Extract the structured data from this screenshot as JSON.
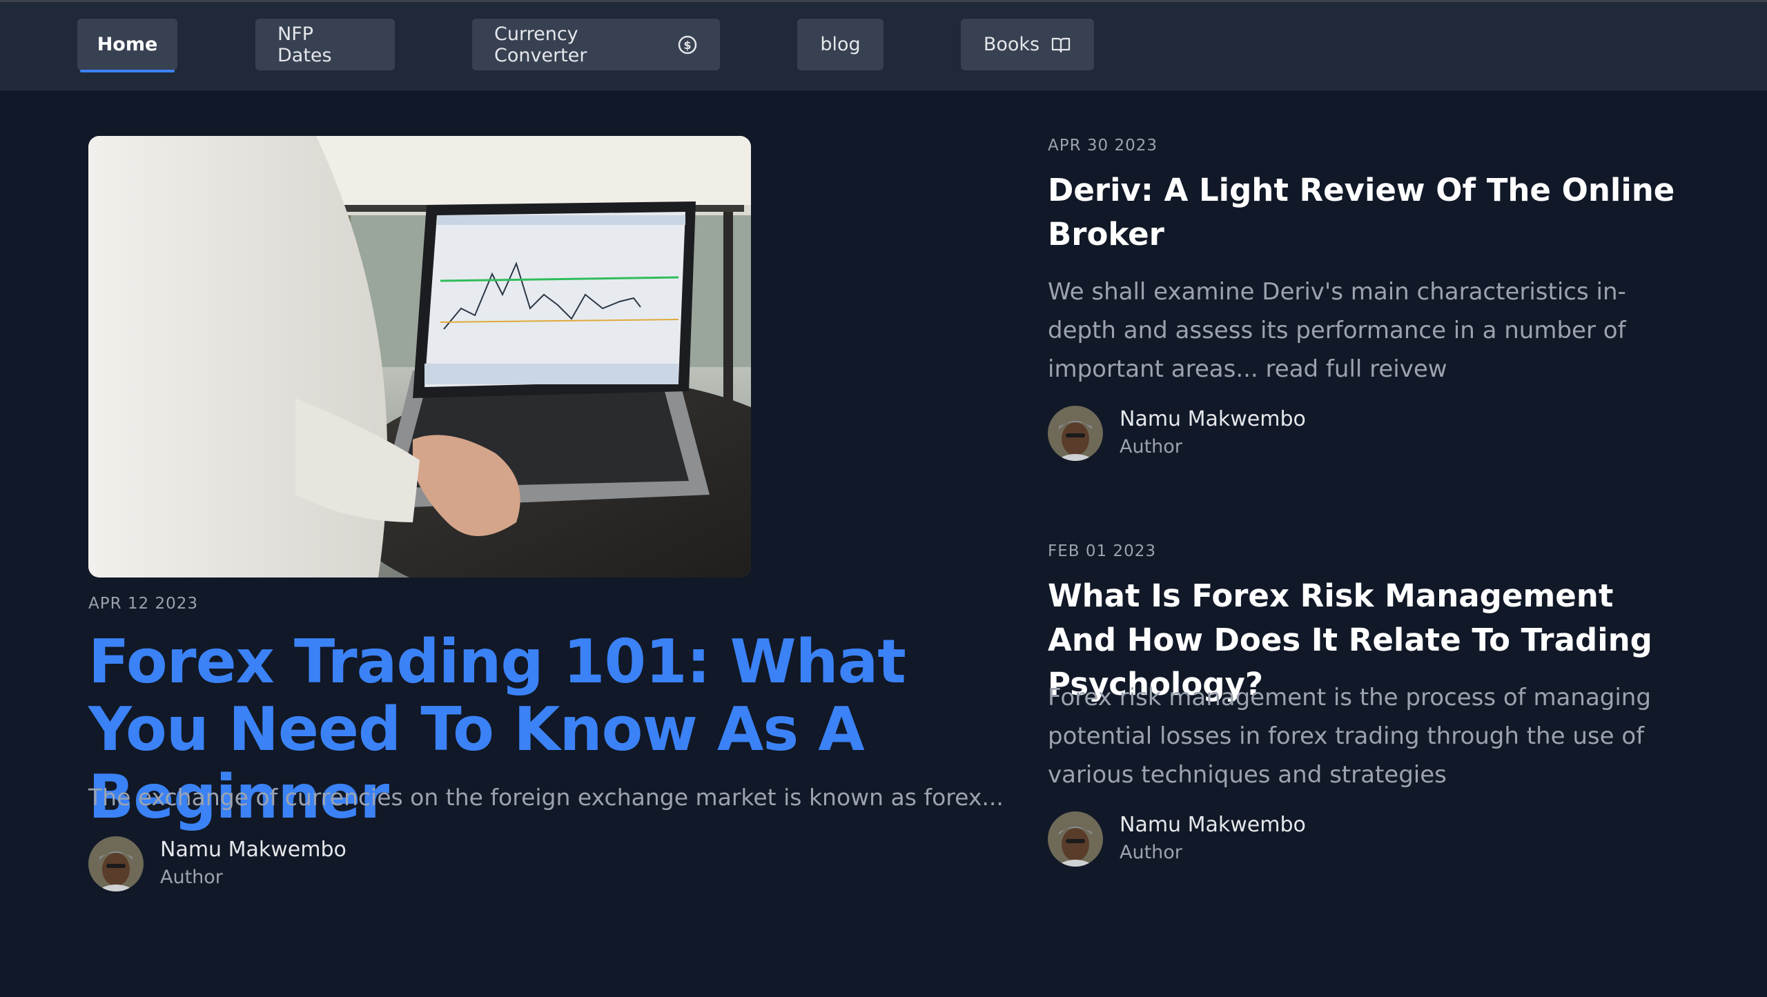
{
  "nav": {
    "home": "Home",
    "nfp": "NFP Dates",
    "converter": "Currency Converter",
    "blog": "blog",
    "books": "Books"
  },
  "featured": {
    "date": "APR 12 2023",
    "title": "Forex Trading 101: What You Need To Know As A Beginner",
    "excerpt": "The exchange of currencies on the foreign exchange market is known as forex...",
    "image_icon": "laptop-trading-chart-photo",
    "author_name": "Namu Makwembo",
    "author_role": "Author"
  },
  "posts": [
    {
      "date": "APR 30 2023",
      "title": "Deriv: A Light Review Of The Online Broker",
      "excerpt": "We shall examine Deriv's main characteristics in-depth and assess its performance in a number of important areas... read full reivew",
      "author_name": "Namu Makwembo",
      "author_role": "Author"
    },
    {
      "date": "FEB 01 2023",
      "title": "What Is Forex Risk Management And How Does It Relate To Trading Psychology?",
      "excerpt": "Forex risk management is the process of managing potential losses in forex trading through the use of various techniques and strategies",
      "author_name": "Namu Makwembo",
      "author_role": "Author"
    }
  ],
  "colors": {
    "background": "#111827",
    "navbar": "#1f2937",
    "accent": "#3b82f6"
  }
}
